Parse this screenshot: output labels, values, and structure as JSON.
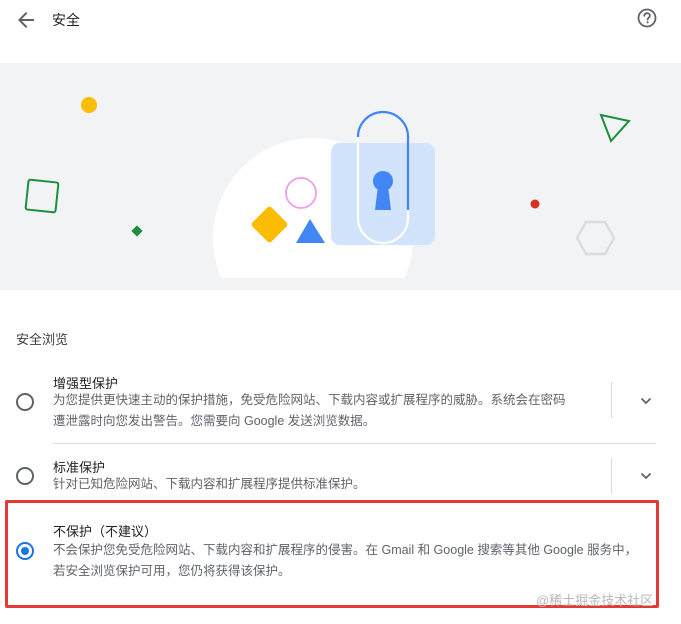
{
  "header": {
    "back_icon": "arrow-back-icon",
    "title": "安全",
    "help_icon": "help-circle-icon"
  },
  "hero": {
    "illustration": "security-lock-illustration",
    "colors": {
      "band": "#f1f3f4",
      "lock_body": "#d2e3fc",
      "lock_shackle": "#4285f4",
      "keyhole": "#4285f4",
      "yellow": "#fbbc04",
      "green": "#1e8e3e",
      "red": "#d93025",
      "pink": "#ee9ced",
      "grey": "#dadce0"
    }
  },
  "safe_browsing": {
    "heading": "安全浏览",
    "options": [
      {
        "label": "增强型保护",
        "description_line1": "为您提供更快速主动的保护措施，免受危险网站、下载内容或扩展程序的威胁。系统会在密码",
        "description_line2": "遭泄露时向您发出警告。您需要向 Google 发送浏览数据。",
        "selected": false,
        "expand_icon": "chevron-down-icon"
      },
      {
        "label": "标准保护",
        "description_line1": "针对已知危险网站、下载内容和扩展程序提供标准保护。",
        "selected": false,
        "expand_icon": "chevron-down-icon"
      },
      {
        "label": "不保护（不建议）",
        "description_line1": "不会保护您免受危险网站、下载内容和扩展程序的侵害。在 Gmail 和 Google 搜索等其他 Google 服务中，",
        "description_line2": "若安全浏览保护可用，您仍将获得该保护。",
        "selected": true
      }
    ]
  },
  "annotation": {
    "highlight_color": "#e53935"
  },
  "watermark": "@稀土掘金技术社区",
  "colors": {
    "accent": "#1a73e8",
    "text_secondary": "#5f6368"
  }
}
